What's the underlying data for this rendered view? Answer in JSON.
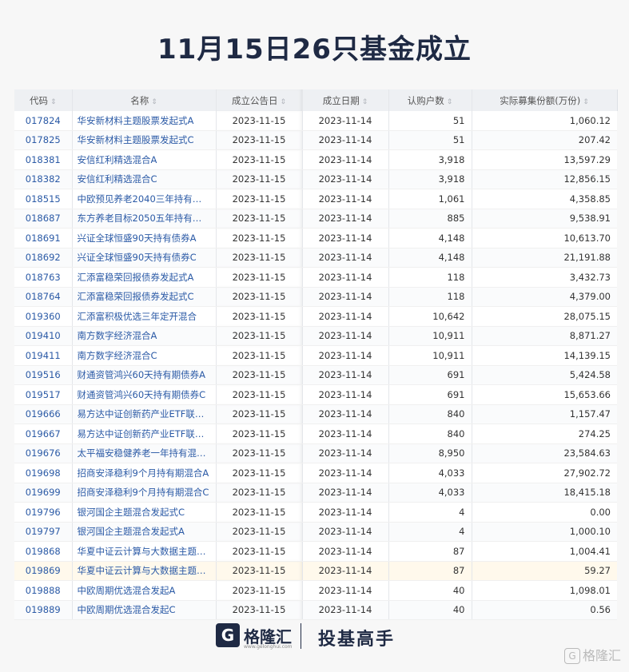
{
  "title": "11月15日26只基金成立",
  "table": {
    "headers": {
      "code": "代码",
      "name": "名称",
      "announce_date": "成立公告日",
      "establish_date": "成立日期",
      "subscribers": "认购户数",
      "amount": "实际募集份额(万份)"
    },
    "sort_icon": "⇕",
    "rows": [
      {
        "code": "017824",
        "name": "华安新材料主题股票发起式A",
        "announce": "2023-11-15",
        "established": "2023-11-14",
        "subscribers": "51",
        "amount": "1,060.12"
      },
      {
        "code": "017825",
        "name": "华安新材料主题股票发起式C",
        "announce": "2023-11-15",
        "established": "2023-11-14",
        "subscribers": "51",
        "amount": "207.42"
      },
      {
        "code": "018381",
        "name": "安信红利精选混合A",
        "announce": "2023-11-15",
        "established": "2023-11-14",
        "subscribers": "3,918",
        "amount": "13,597.29"
      },
      {
        "code": "018382",
        "name": "安信红利精选混合C",
        "announce": "2023-11-15",
        "established": "2023-11-14",
        "subscribers": "3,918",
        "amount": "12,856.15"
      },
      {
        "code": "018515",
        "name": "中欧预见养老2040三年持有混合...",
        "announce": "2023-11-15",
        "established": "2023-11-14",
        "subscribers": "1,061",
        "amount": "4,358.85"
      },
      {
        "code": "018687",
        "name": "东方养老目标2050五年持有混合...",
        "announce": "2023-11-15",
        "established": "2023-11-14",
        "subscribers": "885",
        "amount": "9,538.91"
      },
      {
        "code": "018691",
        "name": "兴证全球恒盛90天持有债券A",
        "announce": "2023-11-15",
        "established": "2023-11-14",
        "subscribers": "4,148",
        "amount": "10,613.70"
      },
      {
        "code": "018692",
        "name": "兴证全球恒盛90天持有债券C",
        "announce": "2023-11-15",
        "established": "2023-11-14",
        "subscribers": "4,148",
        "amount": "21,191.88"
      },
      {
        "code": "018763",
        "name": "汇添富稳荣回报债券发起式A",
        "announce": "2023-11-15",
        "established": "2023-11-14",
        "subscribers": "118",
        "amount": "3,432.73"
      },
      {
        "code": "018764",
        "name": "汇添富稳荣回报债券发起式C",
        "announce": "2023-11-15",
        "established": "2023-11-14",
        "subscribers": "118",
        "amount": "4,379.00"
      },
      {
        "code": "019360",
        "name": "汇添富积极优选三年定开混合",
        "announce": "2023-11-15",
        "established": "2023-11-14",
        "subscribers": "10,642",
        "amount": "28,075.15"
      },
      {
        "code": "019410",
        "name": "南方数字经济混合A",
        "announce": "2023-11-15",
        "established": "2023-11-14",
        "subscribers": "10,911",
        "amount": "8,871.27"
      },
      {
        "code": "019411",
        "name": "南方数字经济混合C",
        "announce": "2023-11-15",
        "established": "2023-11-14",
        "subscribers": "10,911",
        "amount": "14,139.15"
      },
      {
        "code": "019516",
        "name": "财通资管鸿兴60天持有期债券A",
        "announce": "2023-11-15",
        "established": "2023-11-14",
        "subscribers": "691",
        "amount": "5,424.58"
      },
      {
        "code": "019517",
        "name": "财通资管鸿兴60天持有期债券C",
        "announce": "2023-11-15",
        "established": "2023-11-14",
        "subscribers": "691",
        "amount": "15,653.66"
      },
      {
        "code": "019666",
        "name": "易方达中证创新药产业ETF联接...",
        "announce": "2023-11-15",
        "established": "2023-11-14",
        "subscribers": "840",
        "amount": "1,157.47"
      },
      {
        "code": "019667",
        "name": "易方达中证创新药产业ETF联接...",
        "announce": "2023-11-15",
        "established": "2023-11-14",
        "subscribers": "840",
        "amount": "274.25"
      },
      {
        "code": "019676",
        "name": "太平福安稳健养老一年持有混合(...",
        "announce": "2023-11-15",
        "established": "2023-11-14",
        "subscribers": "8,950",
        "amount": "23,584.63"
      },
      {
        "code": "019698",
        "name": "招商安泽稳利9个月持有期混合A",
        "announce": "2023-11-15",
        "established": "2023-11-14",
        "subscribers": "4,033",
        "amount": "27,902.72"
      },
      {
        "code": "019699",
        "name": "招商安泽稳利9个月持有期混合C",
        "announce": "2023-11-15",
        "established": "2023-11-14",
        "subscribers": "4,033",
        "amount": "18,415.18"
      },
      {
        "code": "019796",
        "name": "银河国企主题混合发起式C",
        "announce": "2023-11-15",
        "established": "2023-11-14",
        "subscribers": "4",
        "amount": "0.00"
      },
      {
        "code": "019797",
        "name": "银河国企主题混合发起式A",
        "announce": "2023-11-15",
        "established": "2023-11-14",
        "subscribers": "4",
        "amount": "1,000.10"
      },
      {
        "code": "019868",
        "name": "华夏中证云计算与大数据主题ET...",
        "announce": "2023-11-15",
        "established": "2023-11-14",
        "subscribers": "87",
        "amount": "1,004.41"
      },
      {
        "code": "019869",
        "name": "华夏中证云计算与大数据主题ET...",
        "announce": "2023-11-15",
        "established": "2023-11-14",
        "subscribers": "87",
        "amount": "59.27"
      },
      {
        "code": "019888",
        "name": "中欧周期优选混合发起A",
        "announce": "2023-11-15",
        "established": "2023-11-14",
        "subscribers": "40",
        "amount": "1,098.01"
      },
      {
        "code": "019889",
        "name": "中欧周期优选混合发起C",
        "announce": "2023-11-15",
        "established": "2023-11-14",
        "subscribers": "40",
        "amount": "0.56"
      }
    ]
  },
  "footer": {
    "logo_mark": "G",
    "logo_text": "格隆汇",
    "logo_url": "www.gelonghui.com",
    "slogan": "投基高手"
  },
  "watermark": {
    "icon": "G",
    "text": "格隆汇"
  },
  "highlight_row_index": 23
}
